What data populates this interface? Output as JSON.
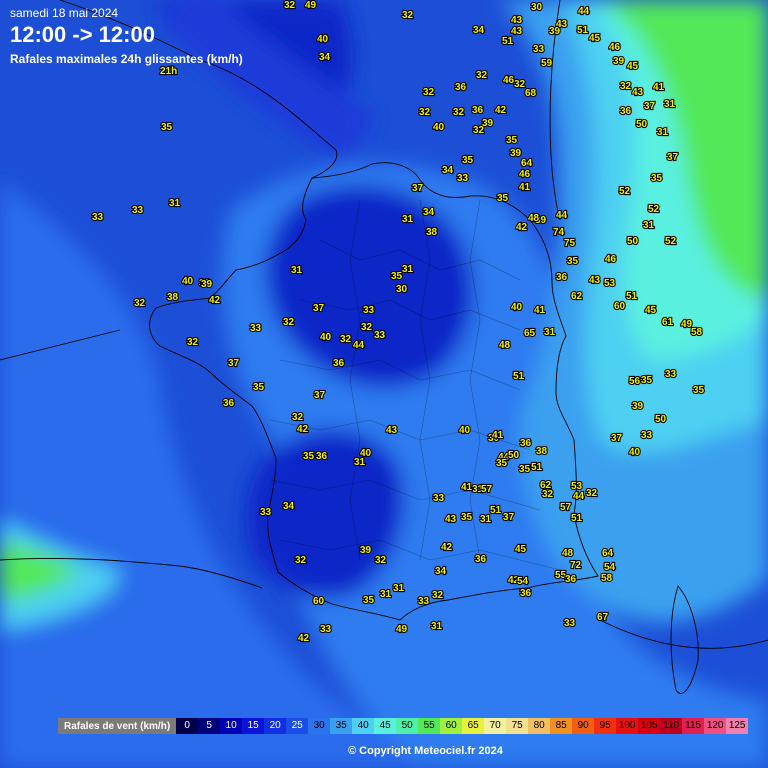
{
  "header": {
    "date": "samedi 18 mai 2024",
    "time_range": "12:00 -> 12:00",
    "subtitle": "Rafales maximales 24h glissantes (km/h)"
  },
  "legend": {
    "title": "Rafales de vent (km/h)",
    "steps": [
      {
        "label": "0",
        "color": "#00004a",
        "text": "#ffffff"
      },
      {
        "label": "5",
        "color": "#00007a",
        "text": "#ffffff"
      },
      {
        "label": "10",
        "color": "#0000b4",
        "text": "#ffffff"
      },
      {
        "label": "15",
        "color": "#0a14d8",
        "text": "#ffffff"
      },
      {
        "label": "20",
        "color": "#1230e0",
        "text": "#ffffff"
      },
      {
        "label": "25",
        "color": "#1a4ee6",
        "text": "#ffffff"
      },
      {
        "label": "30",
        "color": "#2a74ee",
        "text": "#000000"
      },
      {
        "label": "35",
        "color": "#3aa0f0",
        "text": "#000000"
      },
      {
        "label": "40",
        "color": "#4ed0f2",
        "text": "#000000"
      },
      {
        "label": "45",
        "color": "#5af0e0",
        "text": "#000000"
      },
      {
        "label": "50",
        "color": "#4ef0a8",
        "text": "#000000"
      },
      {
        "label": "55",
        "color": "#52e858",
        "text": "#000000"
      },
      {
        "label": "60",
        "color": "#a0f040",
        "text": "#000000"
      },
      {
        "label": "65",
        "color": "#e8f040",
        "text": "#000000"
      },
      {
        "label": "70",
        "color": "#f0f0a0",
        "text": "#000000"
      },
      {
        "label": "75",
        "color": "#f0e090",
        "text": "#000000"
      },
      {
        "label": "80",
        "color": "#f0c060",
        "text": "#000000"
      },
      {
        "label": "85",
        "color": "#f09020",
        "text": "#000000"
      },
      {
        "label": "90",
        "color": "#f06010",
        "text": "#000000"
      },
      {
        "label": "95",
        "color": "#f03010",
        "text": "#000000"
      },
      {
        "label": "100",
        "color": "#e81010",
        "text": "#000000"
      },
      {
        "label": "105",
        "color": "#d80010",
        "text": "#000000"
      },
      {
        "label": "110",
        "color": "#c00020",
        "text": "#000000"
      },
      {
        "label": "115",
        "color": "#e02050",
        "text": "#000000"
      },
      {
        "label": "120",
        "color": "#f05080",
        "text": "#000000"
      },
      {
        "label": "125",
        "color": "#f080b0",
        "text": "#000000"
      }
    ]
  },
  "copyright": "© Copyright Meteociel.fr 2024",
  "stations": [
    {
      "v": "32"
    },
    {
      "v": "49"
    },
    {
      "v": "32"
    },
    {
      "v": "40"
    },
    {
      "v": "34"
    },
    {
      "v": "21h"
    },
    {
      "v": "35"
    },
    {
      "v": "31"
    },
    {
      "v": "33"
    },
    {
      "v": "33"
    },
    {
      "v": "43"
    },
    {
      "v": "34"
    },
    {
      "v": "32"
    },
    {
      "v": "36"
    },
    {
      "v": "32"
    },
    {
      "v": "32"
    },
    {
      "v": "36"
    },
    {
      "v": "32"
    },
    {
      "v": "40"
    },
    {
      "v": "32"
    },
    {
      "v": "35"
    },
    {
      "v": "34"
    },
    {
      "v": "33"
    },
    {
      "v": "37"
    },
    {
      "v": "34"
    },
    {
      "v": "31"
    },
    {
      "v": "38"
    },
    {
      "v": "31"
    },
    {
      "v": "35"
    },
    {
      "v": "30"
    },
    {
      "v": "31"
    },
    {
      "v": "32"
    },
    {
      "v": "33"
    },
    {
      "v": "44"
    },
    {
      "v": "37"
    },
    {
      "v": "40"
    },
    {
      "v": "32"
    },
    {
      "v": "40"
    },
    {
      "v": "30"
    },
    {
      "v": "42"
    },
    {
      "v": "39"
    },
    {
      "v": "38"
    },
    {
      "v": "32"
    },
    {
      "v": "33"
    },
    {
      "v": "33"
    },
    {
      "v": "32"
    },
    {
      "v": "32"
    },
    {
      "v": "37"
    },
    {
      "v": "35"
    },
    {
      "v": "36"
    },
    {
      "v": "36"
    },
    {
      "v": "37"
    },
    {
      "v": "32"
    },
    {
      "v": "42"
    },
    {
      "v": "43"
    },
    {
      "v": "35"
    },
    {
      "v": "36"
    },
    {
      "v": "40"
    },
    {
      "v": "31"
    },
    {
      "v": "34"
    },
    {
      "v": "33"
    },
    {
      "v": "32"
    },
    {
      "v": "39"
    },
    {
      "v": "32"
    },
    {
      "v": "42"
    },
    {
      "v": "49"
    },
    {
      "v": "60"
    },
    {
      "v": "33"
    },
    {
      "v": "31"
    },
    {
      "v": "31"
    },
    {
      "v": "35"
    },
    {
      "v": "33"
    },
    {
      "v": "31"
    },
    {
      "v": "32"
    },
    {
      "v": "34"
    },
    {
      "v": "36"
    },
    {
      "v": "42"
    },
    {
      "v": "33"
    },
    {
      "v": "35"
    },
    {
      "v": "31"
    },
    {
      "v": "51"
    },
    {
      "v": "37"
    },
    {
      "v": "43"
    },
    {
      "v": "31"
    },
    {
      "v": "57"
    },
    {
      "v": "44"
    },
    {
      "v": "35"
    },
    {
      "v": "40"
    },
    {
      "v": "41"
    },
    {
      "v": "45"
    },
    {
      "v": "53"
    },
    {
      "v": "32"
    },
    {
      "v": "54"
    },
    {
      "v": "64"
    },
    {
      "v": "58"
    },
    {
      "v": "67"
    },
    {
      "v": "33"
    },
    {
      "v": "36"
    },
    {
      "v": "42"
    },
    {
      "v": "54"
    },
    {
      "v": "55"
    },
    {
      "v": "48"
    },
    {
      "v": "72"
    },
    {
      "v": "36"
    },
    {
      "v": "51"
    },
    {
      "v": "44"
    },
    {
      "v": "57"
    },
    {
      "v": "62"
    },
    {
      "v": "51"
    },
    {
      "v": "38"
    },
    {
      "v": "50"
    },
    {
      "v": "35"
    },
    {
      "v": "32"
    },
    {
      "v": "36"
    },
    {
      "v": "30"
    },
    {
      "v": "41"
    },
    {
      "v": "51"
    },
    {
      "v": "48"
    },
    {
      "v": "65"
    },
    {
      "v": "31"
    },
    {
      "v": "41"
    },
    {
      "v": "40"
    },
    {
      "v": "36"
    },
    {
      "v": "35"
    },
    {
      "v": "75"
    },
    {
      "v": "74"
    },
    {
      "v": "44"
    },
    {
      "v": "39"
    },
    {
      "v": "48"
    },
    {
      "v": "35"
    },
    {
      "v": "42"
    },
    {
      "v": "41"
    },
    {
      "v": "46"
    },
    {
      "v": "64"
    },
    {
      "v": "39"
    },
    {
      "v": "35"
    },
    {
      "v": "39"
    },
    {
      "v": "42"
    },
    {
      "v": "32"
    },
    {
      "v": "68"
    },
    {
      "v": "46"
    },
    {
      "v": "59"
    },
    {
      "v": "33"
    },
    {
      "v": "51"
    },
    {
      "v": "43"
    },
    {
      "v": "30"
    },
    {
      "v": "39"
    },
    {
      "v": "44"
    },
    {
      "v": "43"
    },
    {
      "v": "51"
    },
    {
      "v": "45"
    },
    {
      "v": "46"
    },
    {
      "v": "39"
    },
    {
      "v": "45"
    },
    {
      "v": "32"
    },
    {
      "v": "43"
    },
    {
      "v": "36"
    },
    {
      "v": "50"
    },
    {
      "v": "41"
    },
    {
      "v": "31"
    },
    {
      "v": "37"
    },
    {
      "v": "31"
    },
    {
      "v": "37"
    },
    {
      "v": "35"
    },
    {
      "v": "52"
    },
    {
      "v": "52"
    },
    {
      "v": "31"
    },
    {
      "v": "50"
    },
    {
      "v": "52"
    },
    {
      "v": "46"
    },
    {
      "v": "43"
    },
    {
      "v": "62"
    },
    {
      "v": "53"
    },
    {
      "v": "60"
    },
    {
      "v": "51"
    },
    {
      "v": "45"
    },
    {
      "v": "61"
    },
    {
      "v": "49"
    },
    {
      "v": "58"
    },
    {
      "v": "35"
    },
    {
      "v": "33"
    },
    {
      "v": "35"
    },
    {
      "v": "56"
    },
    {
      "v": "39"
    },
    {
      "v": "50"
    },
    {
      "v": "33"
    },
    {
      "v": "37"
    },
    {
      "v": "40"
    }
  ]
}
